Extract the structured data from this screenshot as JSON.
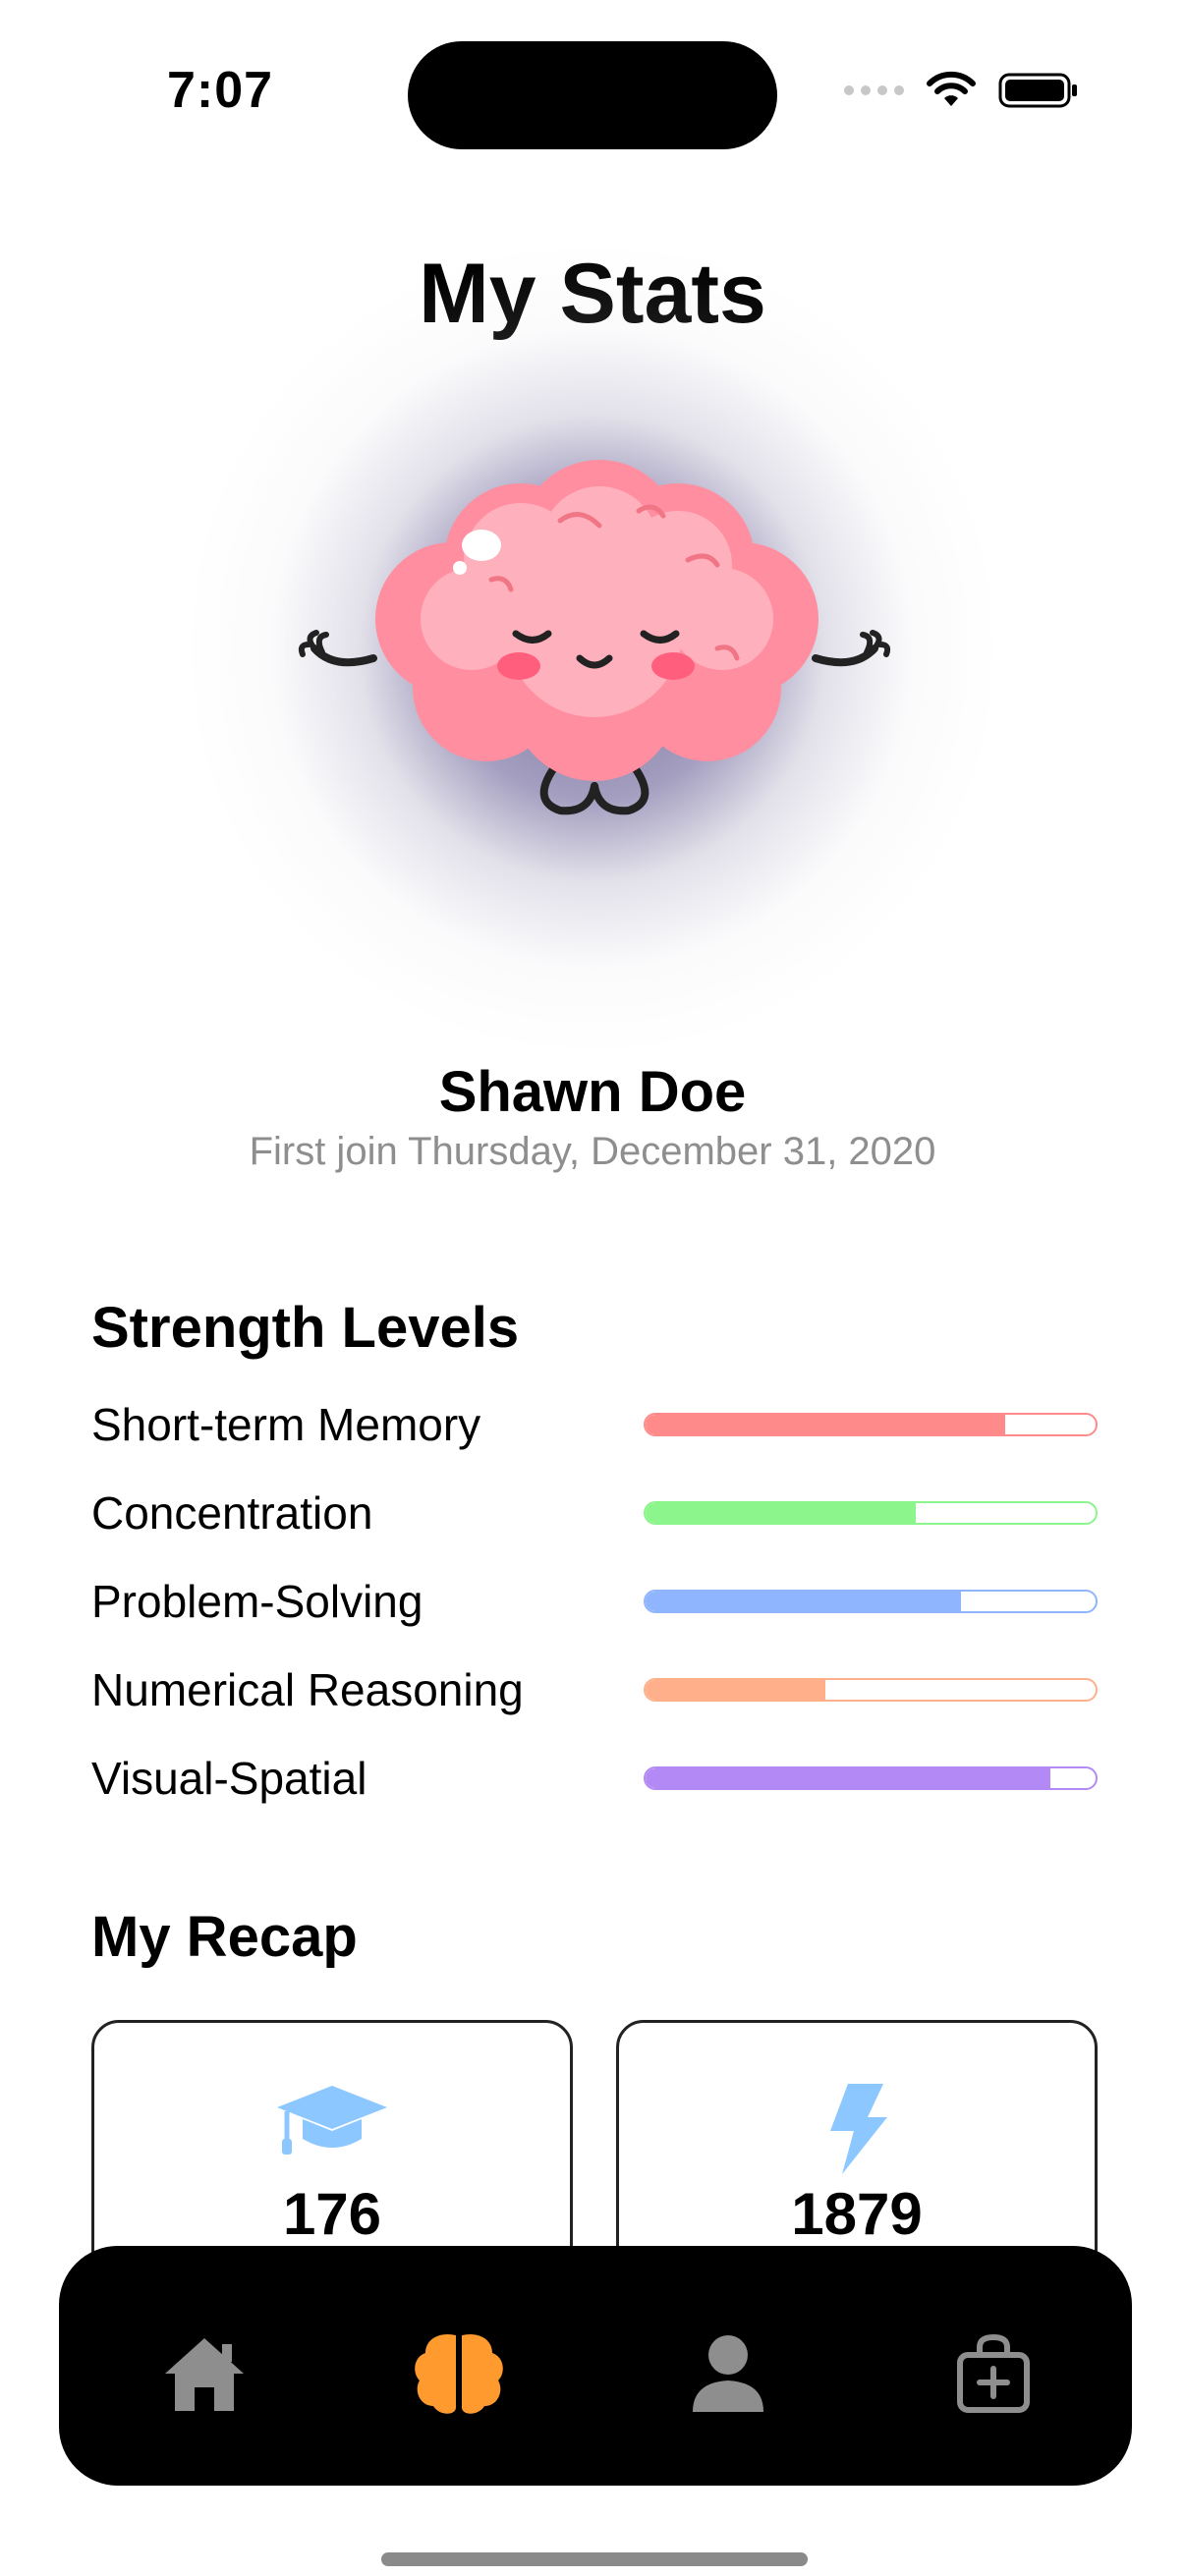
{
  "status_bar": {
    "time": "7:07"
  },
  "page": {
    "title": "My Stats"
  },
  "profile": {
    "name": "Shawn Doe",
    "join_text": "First join Thursday, December 31, 2020"
  },
  "strength": {
    "title": "Strength Levels",
    "items": [
      {
        "label": "Short-term Memory",
        "level": 0.8,
        "color": "#ff8a8a"
      },
      {
        "label": "Concentration",
        "level": 0.6,
        "color": "#8cf58c"
      },
      {
        "label": "Problem-Solving",
        "level": 0.7,
        "color": "#8fb5ff"
      },
      {
        "label": "Numerical Reasoning",
        "level": 0.4,
        "color": "#ffb08a"
      },
      {
        "label": "Visual-Spatial",
        "level": 0.9,
        "color": "#b38af5"
      }
    ]
  },
  "recap": {
    "title": "My Recap",
    "cards": [
      {
        "icon": "graduation-cap-icon",
        "value": "176",
        "color": "#8cc8ff"
      },
      {
        "icon": "lightning-bolt-icon",
        "value": "1879",
        "color": "#8cc8ff"
      }
    ]
  },
  "tab_bar": {
    "tabs": [
      {
        "icon": "home-icon",
        "active": false
      },
      {
        "icon": "brain-icon",
        "active": true
      },
      {
        "icon": "person-icon",
        "active": false
      },
      {
        "icon": "shopping-bag-plus-icon",
        "active": false
      }
    ],
    "active_color": "#ff9a2e",
    "inactive_color": "#8e8e8e"
  }
}
